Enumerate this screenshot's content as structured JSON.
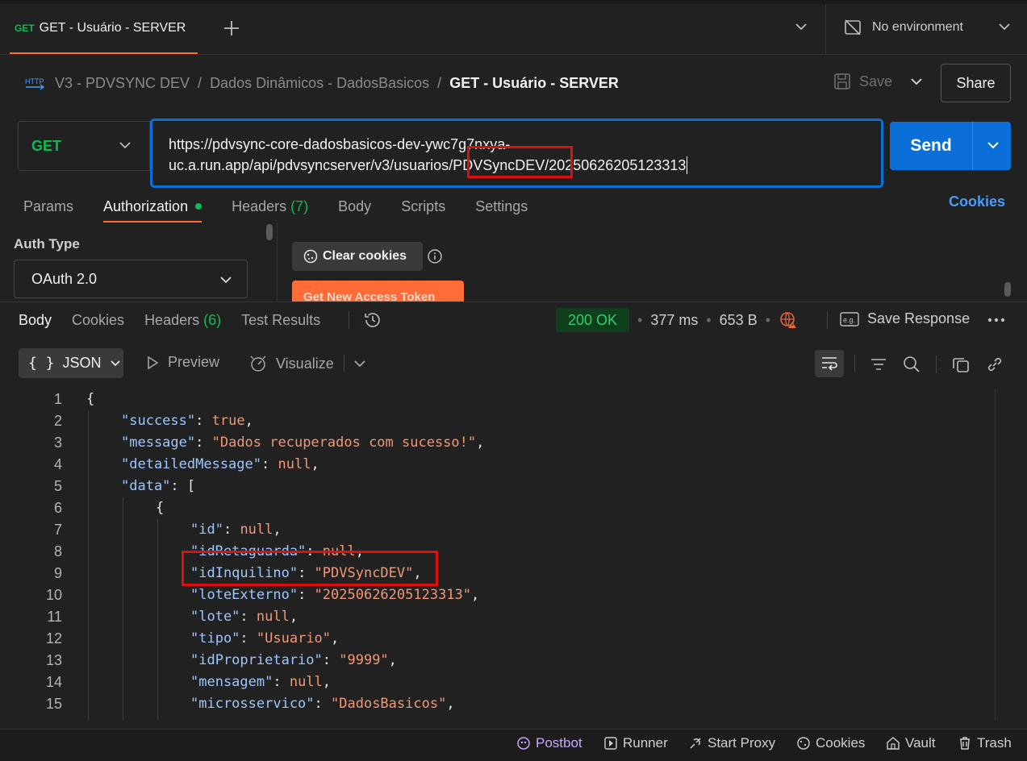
{
  "tab": {
    "method": "GET",
    "title": "GET - Usuário - SERVER"
  },
  "environment": {
    "label": "No environment"
  },
  "breadcrumb": {
    "collection": "V3 - PDVSYNC DEV",
    "folder": "Dados Dinâmicos - DadosBasicos",
    "request": "GET - Usuário - SERVER",
    "sep": "/"
  },
  "toolbar": {
    "save_label": "Save",
    "share_label": "Share"
  },
  "request": {
    "method": "GET",
    "url_part1": "https://pdvsync-core-dadosbasicos-dev-ywc7g7nxya-",
    "url_part2a": "uc.a.run.app/api/pdvsyncserver/v3/usuarios",
    "url_part2b": "/PDVSyncDEV/",
    "url_part2c": "20250626205123313",
    "send_label": "Send"
  },
  "request_tabs": [
    {
      "label": "Params"
    },
    {
      "label": "Authorization"
    },
    {
      "label": "Headers",
      "count": "(7)"
    },
    {
      "label": "Body"
    },
    {
      "label": "Scripts"
    },
    {
      "label": "Settings"
    }
  ],
  "cookies_link": "Cookies",
  "auth": {
    "type_label": "Auth Type",
    "type_value": "OAuth 2.0",
    "clear_cookies": "Clear cookies",
    "get_token": "Get New Access Token"
  },
  "response_tabs": [
    {
      "label": "Body"
    },
    {
      "label": "Cookies"
    },
    {
      "label": "Headers",
      "count": "(6)"
    },
    {
      "label": "Test Results"
    }
  ],
  "response_meta": {
    "status": "200 OK",
    "time": "377 ms",
    "size": "653 B",
    "save_response": "Save Response"
  },
  "viewer": {
    "format": "JSON",
    "preview": "Preview",
    "visualize": "Visualize"
  },
  "code_lines": [
    {
      "n": "1"
    },
    {
      "n": "2"
    },
    {
      "n": "3"
    },
    {
      "n": "4"
    },
    {
      "n": "5"
    },
    {
      "n": "6"
    },
    {
      "n": "7"
    },
    {
      "n": "8"
    },
    {
      "n": "9"
    },
    {
      "n": "10"
    },
    {
      "n": "11"
    },
    {
      "n": "12"
    },
    {
      "n": "13"
    },
    {
      "n": "14"
    },
    {
      "n": "15"
    }
  ],
  "json": {
    "l1": "{",
    "success_k": "\"success\"",
    "success_v": "true",
    "message_k": "\"message\"",
    "message_v": "\"Dados recuperados com sucesso!\"",
    "detailed_k": "\"detailedMessage\"",
    "detailed_v": "null",
    "data_k": "\"data\"",
    "data_v": "[",
    "obj_open": "{",
    "id_k": "\"id\"",
    "id_v": "null",
    "idret_k": "\"idRetaguarda\"",
    "idret_v": "null",
    "idinq_k": "\"idInquilino\"",
    "idinq_v": "\"PDVSyncDEV\"",
    "lotex_k": "\"loteExterno\"",
    "lotex_v": "\"20250626205123313\"",
    "lote_k": "\"lote\"",
    "lote_v": "null",
    "tipo_k": "\"tipo\"",
    "tipo_v": "\"Usuario\"",
    "idprop_k": "\"idProprietario\"",
    "idprop_v": "\"9999\"",
    "msg_k": "\"mensagem\"",
    "msg_v": "null",
    "micro_k": "\"microsservico\"",
    "micro_v": "\"DadosBasicos\""
  },
  "statusbar": {
    "postbot": "Postbot",
    "runner": "Runner",
    "proxy": "Start Proxy",
    "cookies": "Cookies",
    "vault": "Vault",
    "trash": "Trash"
  }
}
